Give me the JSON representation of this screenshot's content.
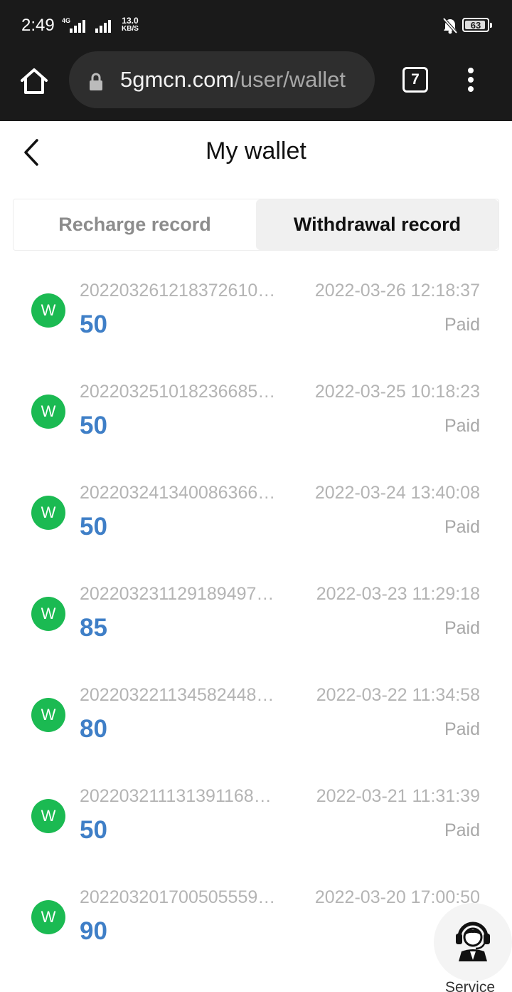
{
  "status_bar": {
    "time": "2:49",
    "network": "4G",
    "speed_value": "13.0",
    "speed_unit": "KB/S",
    "battery": "63"
  },
  "browser": {
    "url_host": "5gmcn.com",
    "url_path": "/user/wallet",
    "tab_count": "7"
  },
  "page": {
    "title": "My wallet"
  },
  "tabs": [
    {
      "label": "Recharge record",
      "active": false
    },
    {
      "label": "Withdrawal record",
      "active": true
    }
  ],
  "records": [
    {
      "icon_letter": "W",
      "id": "202203261218372610…",
      "time": "2022-03-26 12:18:37",
      "amount": "50",
      "status": "Paid"
    },
    {
      "icon_letter": "W",
      "id": "202203251018236685…",
      "time": "2022-03-25 10:18:23",
      "amount": "50",
      "status": "Paid"
    },
    {
      "icon_letter": "W",
      "id": "202203241340086366…",
      "time": "2022-03-24 13:40:08",
      "amount": "50",
      "status": "Paid"
    },
    {
      "icon_letter": "W",
      "id": "202203231129189497…",
      "time": "2022-03-23 11:29:18",
      "amount": "85",
      "status": "Paid"
    },
    {
      "icon_letter": "W",
      "id": "202203221134582448…",
      "time": "2022-03-22 11:34:58",
      "amount": "80",
      "status": "Paid"
    },
    {
      "icon_letter": "W",
      "id": "202203211131391168…",
      "time": "2022-03-21 11:31:39",
      "amount": "50",
      "status": "Paid"
    },
    {
      "icon_letter": "W",
      "id": "202203201700505559…",
      "time": "2022-03-20 17:00:50",
      "amount": "90",
      "status": ""
    }
  ],
  "service": {
    "label": "Service",
    "icon": "customer-service-headset-icon"
  },
  "colors": {
    "accent_amount": "#3f7fc7",
    "icon_green": "#1bba52",
    "chrome_bg": "#1a1a1a"
  }
}
